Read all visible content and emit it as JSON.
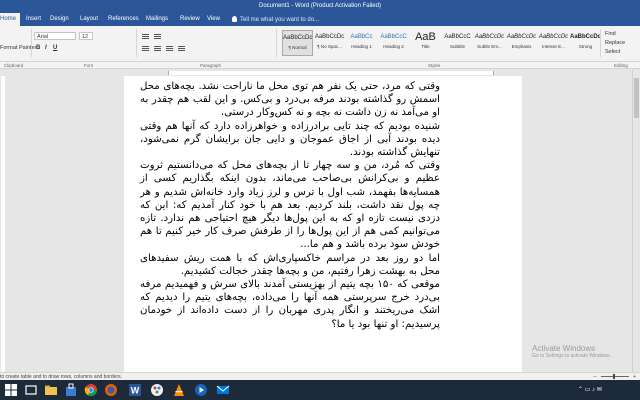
{
  "window": {
    "title": "Document1 - Word (Product Activation Failed)"
  },
  "ribbon_tabs": {
    "home": "Home",
    "insert": "Insert",
    "design": "Design",
    "layout": "Layout",
    "references": "References",
    "mailings": "Mailings",
    "review": "Review",
    "view": "View",
    "tell_me": "Tell me what you want to do..."
  },
  "clipboard": {
    "format_painter": "Format Painter",
    "group_label": "Clipboard"
  },
  "font": {
    "name": "Arial",
    "size": "12",
    "bold": "B",
    "italic": "I",
    "underline": "U",
    "group_label": "Font"
  },
  "paragraph": {
    "group_label": "Paragraph"
  },
  "styles": {
    "group_label": "Styles",
    "items": [
      {
        "sample": "AaBbCcDc",
        "name": "¶ Normal"
      },
      {
        "sample": "AaBbCcDc",
        "name": "¶ No Spac..."
      },
      {
        "sample": "AaBbCc",
        "name": "Heading 1"
      },
      {
        "sample": "AaBbCcC",
        "name": "Heading 2"
      },
      {
        "sample": "AaB",
        "name": "Title"
      },
      {
        "sample": "AaBbCcC",
        "name": "Subtitle"
      },
      {
        "sample": "AaBbCcDc",
        "name": "Subtle Em..."
      },
      {
        "sample": "AaBbCcDc",
        "name": "Emphasis"
      },
      {
        "sample": "AaBbCcDc",
        "name": "Intense E..."
      },
      {
        "sample": "AaBbCcDc",
        "name": "Strong"
      }
    ]
  },
  "editing": {
    "find": "Find",
    "replace": "Replace",
    "select": "Select",
    "group_label": "Editing"
  },
  "document": {
    "paragraphs": [
      "وقتی که مرد، حتی یک نفر هم توی محل ما ناراحت نشد. بچه‌های محل اسمش رو گذاشته بودند مرفه بی‌درد و بی‌کس. و این لقب هم چقدر به او می‌آمد نه زن داشت نه بچه و نه کس‌وکار درستی.",
      "شنیده بودیم که چند تایی برادرزاده و خواهرزاده دارد که آنها هم وقتی دیده بودند آبی از اجاق عموجان و دایی جان برایشان گرم نمی‌شود، تنهایش گذاشته بودند.",
      "وقتی که مُرد، من و سه چهار تا از بچه‌های محل که می‌دانستیم ثروت عظیم و بی‌کرانش بی‌صاحب می‌ماند، بدون اینکه بگذاریم کسی از همسایه‌ها بفهمد، شب اول با ترس و لرز زیاد وارد خانه‌اش شدیم و هر چه پول نقد داشت، بلند کردیم. بعد هم با خود کنار آمدیم که: این که دزدی نیست تازه او که به این پول‌ها دیگر هیچ احتیاجی هم ندارد. تازه می‌توانیم کمی هم از این پول‌ها را از طرفش صرف کار خیر کنیم تا هم خودش سود برده باشد و هم ما...",
      "اما دو روز بعد در مراسم خاکسپاری‌اش که با همت ریش سفیدهای محل به بهشت زهرا رفتیم، من و بچه‌ها چقدر خجالت کشیدیم.",
      "موقعی که ۱۵۰ بچه یتیم از بهزیستی آمدند بالای سرش و فهمیدیم مرفه بی‌درد خرج سرپرستی همه آنها را می‌داده، بچه‌های یتیم را دیدیم که اشک می‌ریختند و انگار پدری مهربان را از دست داده‌اند از خودمان پرسیدیم: او تنها بود یا ما؟"
    ]
  },
  "watermark": {
    "line1": "Activate Windows",
    "line2": "Go to Settings to activate Windows."
  },
  "status_bar": {
    "message": "to create table and to draw rows, columns and borders."
  },
  "colors": {
    "title_bar": "#2b579a",
    "taskbar": "#1c2a3a"
  },
  "taskbar_icons": [
    "windows-icon",
    "task-view-icon",
    "file-explorer-icon",
    "store-icon",
    "chrome-icon",
    "firefox-icon",
    "word-icon",
    "paint-icon",
    "vlc-icon",
    "media-icon",
    "mail-icon"
  ]
}
